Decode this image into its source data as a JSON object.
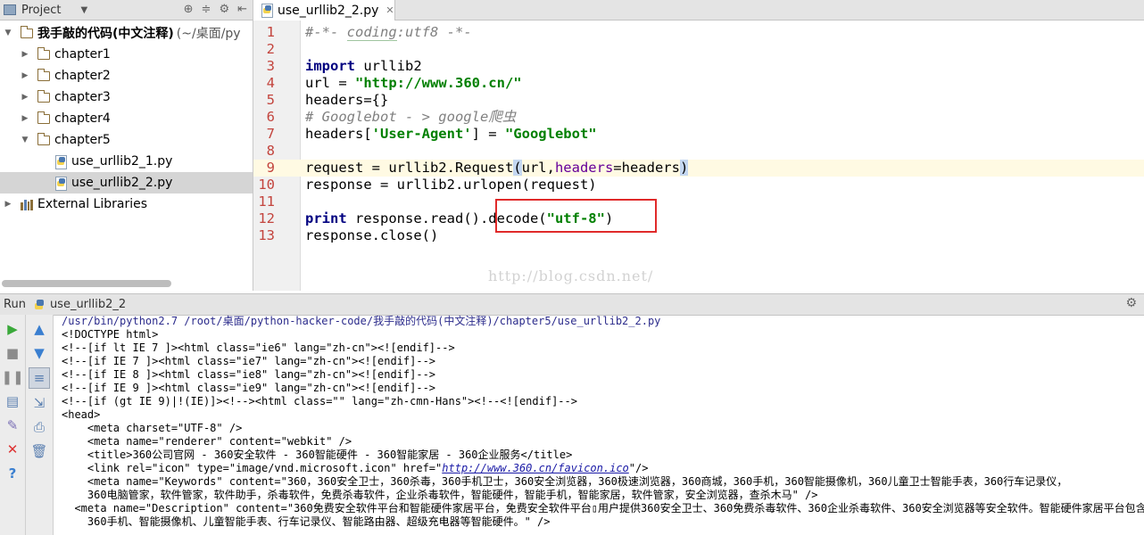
{
  "project": {
    "title": "Project",
    "root_name": "我手敲的代码(中文注释)",
    "root_path": "(~/桌面/py",
    "items": [
      {
        "label": "chapter1",
        "type": "folder",
        "expanded": false
      },
      {
        "label": "chapter2",
        "type": "folder",
        "expanded": false
      },
      {
        "label": "chapter3",
        "type": "folder",
        "expanded": false
      },
      {
        "label": "chapter4",
        "type": "folder",
        "expanded": false
      },
      {
        "label": "chapter5",
        "type": "folder",
        "expanded": true
      },
      {
        "label": "use_urllib2_1.py",
        "type": "file"
      },
      {
        "label": "use_urllib2_2.py",
        "type": "file",
        "selected": true
      }
    ],
    "external": "External Libraries"
  },
  "editor": {
    "tab_label": "use_urllib2_2.py",
    "line_numbers": [
      "1",
      "2",
      "3",
      "4",
      "5",
      "6",
      "7",
      "8",
      "9",
      "10",
      "11",
      "12",
      "13"
    ],
    "watermark": "http://blog.csdn.net/"
  },
  "run": {
    "label": "Run",
    "config": "use_urllib2_2",
    "output": [
      "/usr/bin/python2.7 /root/桌面/python-hacker-code/我手敲的代码(中文注释)/chapter5/use_urllib2_2.py",
      "<!DOCTYPE html>",
      "<!--[if lt IE 7 ]><html class=\"ie6\" lang=\"zh-cn\"><![endif]-->",
      "<!--[if IE 7 ]><html class=\"ie7\" lang=\"zh-cn\"><![endif]-->",
      "<!--[if IE 8 ]><html class=\"ie8\" lang=\"zh-cn\"><![endif]-->",
      "<!--[if IE 9 ]><html class=\"ie9\" lang=\"zh-cn\"><![endif]-->",
      "<!--[if (gt IE 9)|!(IE)]><!--><html class=\"\" lang=\"zh-cmn-Hans\"><!--<![endif]-->",
      "<head>",
      "    <meta charset=\"UTF-8\" />",
      "    <meta name=\"renderer\" content=\"webkit\" />",
      "    <title>360公司官网 - 360安全软件 - 360智能硬件 - 360智能家居 - 360企业服务</title>",
      "    <meta name=\"Keywords\" content=\"360，360安全卫士，360杀毒，360手机卫士，360安全浏览器，360极速浏览器，360商城，360手机，360智能摄像机，360儿童卫士智能手表，360行车记录仪，",
      "    360电脑管家，软件管家，软件助手，杀毒软件，免费杀毒软件，企业杀毒软件，智能硬件，智能手机，智能家居，软件管家，安全浏览器，查杀木马\" />",
      "  <meta name=\"Description\" content=\"360免费安全软件平台和智能硬件家居平台，免费安全软件平台▯用户提供360安全卫士、360免费杀毒软件、360企业杀毒软件、360安全浏览器等安全软件。智能硬件家居平台包含",
      "    360手机、智能摄像机、儿童智能手表、行车记录仪、智能路由器、超级充电器等智能硬件。\" />"
    ],
    "icon_line": {
      "before": "    <link rel=\"icon\" type=\"image/vnd.microsoft.icon\" href=\"",
      "link": "http://www.360.cn/favicon.ico",
      "after": "\"/>"
    }
  },
  "colors": {
    "keyword": "#000080",
    "string": "#008000",
    "comment": "#808080",
    "line_number": "#c3443d",
    "annotation_box": "#e02a2a"
  }
}
